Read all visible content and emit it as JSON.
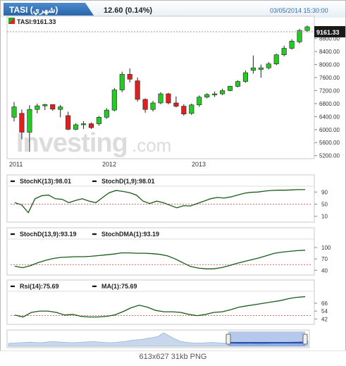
{
  "header": {
    "symbol": "TASI (شهري)",
    "price_change": "12.60 (0.14%)",
    "datetime": "03/05/2014 15:30:00"
  },
  "watermark": {
    "brand": "Investing",
    "suffix": ".com"
  },
  "caption": "613x627  31kb  PNG",
  "colors": {
    "up": "#22cc22",
    "down": "#e02020",
    "line": "#1a5a1a",
    "ref": "#e03030",
    "title_bar": "#2e6fb4",
    "badge": "#1a1a1a"
  },
  "chart_data": [
    {
      "type": "candlestick",
      "legend": "TASI:9161.33",
      "last_value_label": "9161.33",
      "x_tick_labels": [
        "2011",
        "2012",
        "2013"
      ],
      "y_tick_labels": [
        "8800.00",
        "8400.00",
        "8000.00",
        "7600.00",
        "7200.00",
        "6800.00",
        "6400.00",
        "6000.00",
        "5600.00",
        "5200.00"
      ],
      "ylim": [
        5150,
        9400
      ],
      "candles": [
        {
          "o": 6380,
          "h": 6850,
          "l": 6250,
          "c": 6700
        },
        {
          "o": 6500,
          "h": 6620,
          "l": 5700,
          "c": 5920
        },
        {
          "o": 5920,
          "h": 6750,
          "l": 5320,
          "c": 6620
        },
        {
          "o": 6620,
          "h": 6800,
          "l": 6500,
          "c": 6730
        },
        {
          "o": 6730,
          "h": 6800,
          "l": 6600,
          "c": 6770
        },
        {
          "o": 6770,
          "h": 6780,
          "l": 6580,
          "c": 6630
        },
        {
          "o": 6620,
          "h": 6760,
          "l": 6380,
          "c": 6700
        },
        {
          "o": 6430,
          "h": 6550,
          "l": 5980,
          "c": 6010
        },
        {
          "o": 6010,
          "h": 6200,
          "l": 5980,
          "c": 6150
        },
        {
          "o": 6150,
          "h": 6260,
          "l": 6020,
          "c": 6180
        },
        {
          "o": 6180,
          "h": 6220,
          "l": 6020,
          "c": 6060
        },
        {
          "o": 6180,
          "h": 6420,
          "l": 6120,
          "c": 6380
        },
        {
          "o": 6380,
          "h": 6660,
          "l": 6330,
          "c": 6600
        },
        {
          "o": 6600,
          "h": 7280,
          "l": 6560,
          "c": 7220
        },
        {
          "o": 7220,
          "h": 7780,
          "l": 7150,
          "c": 7700
        },
        {
          "o": 7700,
          "h": 7880,
          "l": 7450,
          "c": 7550
        },
        {
          "o": 7500,
          "h": 7600,
          "l": 6860,
          "c": 6930
        },
        {
          "o": 6930,
          "h": 6960,
          "l": 6520,
          "c": 6620
        },
        {
          "o": 6620,
          "h": 6880,
          "l": 6560,
          "c": 6820
        },
        {
          "o": 6820,
          "h": 7150,
          "l": 6780,
          "c": 7100
        },
        {
          "o": 7100,
          "h": 7130,
          "l": 6780,
          "c": 6820
        },
        {
          "o": 6820,
          "h": 7020,
          "l": 6680,
          "c": 6720
        },
        {
          "o": 6720,
          "h": 6780,
          "l": 6430,
          "c": 6480
        },
        {
          "o": 6500,
          "h": 6800,
          "l": 6450,
          "c": 6760
        },
        {
          "o": 6760,
          "h": 7050,
          "l": 6700,
          "c": 7000
        },
        {
          "o": 7000,
          "h": 7120,
          "l": 6960,
          "c": 7080
        },
        {
          "o": 7080,
          "h": 7170,
          "l": 7000,
          "c": 7100
        },
        {
          "o": 7100,
          "h": 7260,
          "l": 7060,
          "c": 7200
        },
        {
          "o": 7200,
          "h": 7350,
          "l": 7180,
          "c": 7330
        },
        {
          "o": 7330,
          "h": 7520,
          "l": 7300,
          "c": 7480
        },
        {
          "o": 7480,
          "h": 7820,
          "l": 7440,
          "c": 7750
        },
        {
          "o": 7820,
          "h": 8280,
          "l": 7720,
          "c": 7900
        },
        {
          "o": 7850,
          "h": 8000,
          "l": 7600,
          "c": 7900
        },
        {
          "o": 7900,
          "h": 8080,
          "l": 7850,
          "c": 8020
        },
        {
          "o": 8020,
          "h": 8340,
          "l": 7980,
          "c": 8300
        },
        {
          "o": 8300,
          "h": 8580,
          "l": 8250,
          "c": 8500
        },
        {
          "o": 8500,
          "h": 8780,
          "l": 8460,
          "c": 8720
        },
        {
          "o": 8700,
          "h": 9100,
          "l": 8650,
          "c": 9050
        },
        {
          "o": 9050,
          "h": 9200,
          "l": 9000,
          "c": 9161
        }
      ]
    },
    {
      "type": "line",
      "legend": [
        {
          "name": "StochK(13):98.01"
        },
        {
          "name": "StochD(1,9):98.01"
        }
      ],
      "y_tick_labels": [
        "90",
        "50",
        "10"
      ],
      "ylim": [
        0,
        100
      ],
      "reference": 50,
      "values": [
        55,
        48,
        22,
        68,
        78,
        80,
        68,
        66,
        55,
        62,
        68,
        60,
        55,
        72,
        88,
        95,
        92,
        88,
        80,
        60,
        52,
        60,
        55,
        46,
        38,
        45,
        44,
        52,
        60,
        68,
        72,
        70,
        74,
        80,
        86,
        89,
        90,
        93,
        95,
        96,
        96,
        97,
        98,
        98
      ]
    },
    {
      "type": "line",
      "legend": [
        {
          "name": "StochD(13,9):93.19"
        },
        {
          "name": "StochDMA(1):93.19"
        }
      ],
      "y_tick_labels": [
        "100",
        "70",
        "40"
      ],
      "ylim": [
        35,
        115
      ],
      "reference": 55,
      "values": [
        51,
        47,
        52,
        60,
        66,
        71,
        74,
        75,
        76,
        76,
        77,
        79,
        81,
        83,
        86,
        86,
        85,
        85,
        84,
        82,
        78,
        70,
        60,
        50,
        46,
        44,
        44,
        47,
        52,
        58,
        63,
        68,
        73,
        79,
        85,
        88,
        90,
        92,
        93
      ]
    },
    {
      "type": "line",
      "legend": [
        {
          "name": "Rsi(14):75.69"
        },
        {
          "name": "MA(1):75.69"
        }
      ],
      "y_tick_labels": [
        "66",
        "54",
        "42"
      ],
      "ylim": [
        38,
        80
      ],
      "reference": 47,
      "values": [
        48,
        45,
        52,
        54,
        54,
        52,
        48,
        49,
        46,
        45,
        45,
        46,
        48,
        53,
        59,
        63,
        60,
        55,
        53,
        53,
        52,
        49,
        47,
        49,
        52,
        53,
        56,
        60,
        62,
        64,
        66,
        68,
        70,
        73,
        75,
        76
      ]
    },
    {
      "type": "area",
      "values": [
        10,
        11,
        12,
        13,
        14,
        13,
        12,
        14,
        16,
        15,
        14,
        13,
        12,
        13,
        14,
        15,
        16,
        14,
        13,
        12,
        13,
        15,
        17,
        20,
        22,
        24,
        27,
        30,
        34,
        46,
        36,
        26,
        18,
        14,
        12,
        11,
        11,
        12,
        13,
        12,
        11,
        11,
        10,
        9,
        8,
        10,
        9,
        8,
        9,
        10,
        11,
        12,
        13,
        14,
        15,
        16,
        18
      ]
    }
  ]
}
